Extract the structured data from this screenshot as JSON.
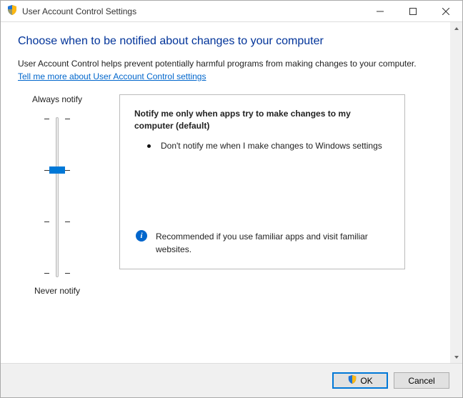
{
  "window": {
    "title": "User Account Control Settings"
  },
  "heading": "Choose when to be notified about changes to your computer",
  "description": "User Account Control helps prevent potentially harmful programs from making changes to your computer.",
  "link": "Tell me more about User Account Control settings",
  "slider": {
    "top_label": "Always notify",
    "bottom_label": "Never notify"
  },
  "panel": {
    "title": "Notify me only when apps try to make changes to my computer (default)",
    "bullet": "Don't notify me when I make changes to Windows settings",
    "recommend": "Recommended if you use familiar apps and visit familiar websites."
  },
  "buttons": {
    "ok": "OK",
    "cancel": "Cancel"
  }
}
